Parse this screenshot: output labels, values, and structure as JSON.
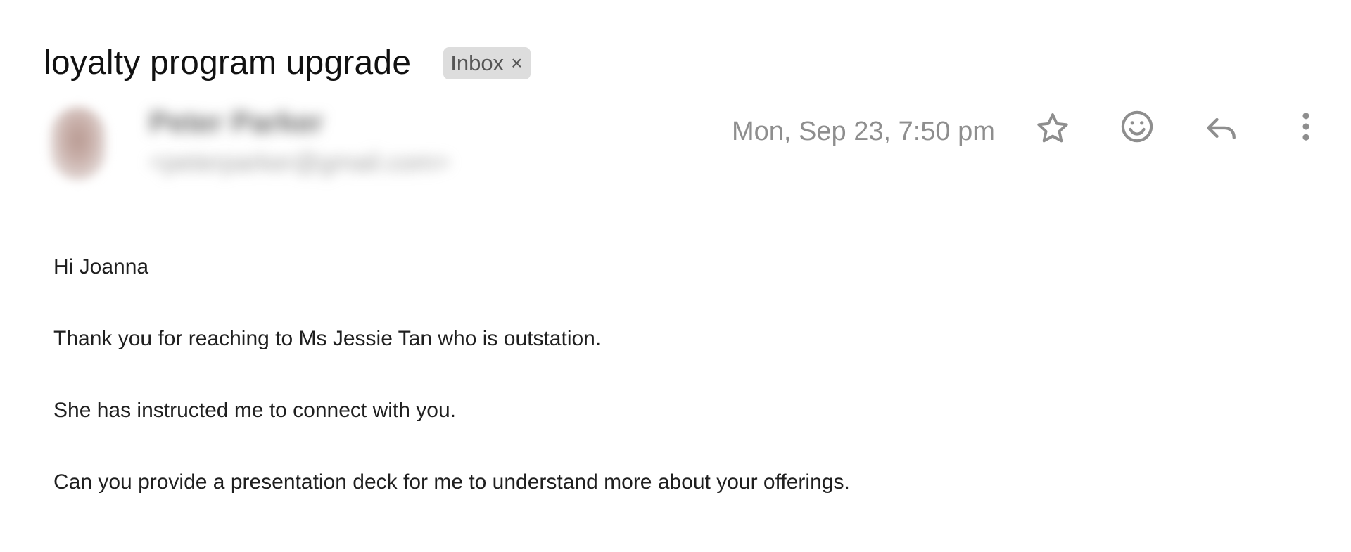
{
  "email": {
    "subject": "loyalty program upgrade",
    "label_chip": {
      "text": "Inbox",
      "close_glyph": "×"
    },
    "sender": {
      "name": "Peter Parker",
      "email": "<peterparker@gmail.com>"
    },
    "date": "Mon, Sep 23, 7:50 pm",
    "actions": [
      {
        "name": "star-icon"
      },
      {
        "name": "emoji-reaction-icon"
      },
      {
        "name": "reply-icon"
      },
      {
        "name": "more-options-icon"
      }
    ],
    "body": [
      "Hi Joanna",
      "Thank you for reaching to Ms Jessie Tan who is outstation.",
      "She has instructed me to connect with you.",
      "Can you provide a presentation deck for me to understand more about your offerings."
    ]
  },
  "colors": {
    "chip_background": "#dddddd",
    "icon_gray": "#8e8e8e",
    "text": "#1f1f1f"
  }
}
